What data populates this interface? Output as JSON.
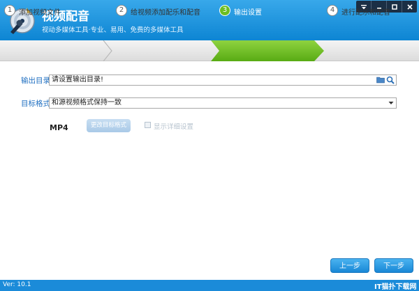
{
  "app": {
    "title": "视频配音",
    "subtitle": "视动多媒体工具·专业、易用、免费的多媒体工具"
  },
  "window_controls": [
    "menu-icon",
    "minimize-icon",
    "maximize-icon",
    "close-icon"
  ],
  "steps": [
    {
      "num": "1",
      "label": "添加视频文件",
      "active": false
    },
    {
      "num": "2",
      "label": "给视频添加配乐和配音",
      "active": false
    },
    {
      "num": "3",
      "label": "输出设置",
      "active": true
    },
    {
      "num": "4",
      "label": "进行配乐和配音",
      "active": false
    }
  ],
  "output": {
    "label": "输出目录:",
    "value": "请设置输出目录!"
  },
  "format": {
    "label": "目标格式:",
    "selected": "和源视频格式保持一致",
    "current": "MP4",
    "change_button": "更改目标格式",
    "details_label": "显示详细设置"
  },
  "buttons": {
    "prev": "上一步",
    "next": "下一步"
  },
  "status": {
    "version": "Ver: 10.1",
    "watermark": "IT猫扑下载网"
  },
  "colors": {
    "titlebar": "#1a90dd",
    "active_step": "#6cbd22",
    "label_blue": "#1f6fc1",
    "button_blue": "#2a9be3"
  }
}
